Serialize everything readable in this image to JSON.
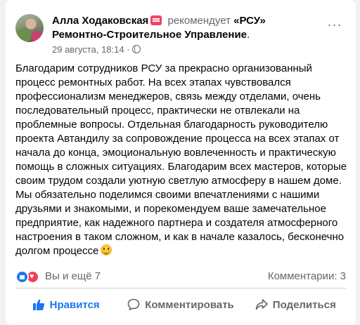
{
  "post": {
    "author": "Алла Ходаковская",
    "recommends_label": "рекомендует",
    "page_name": "«РСУ» Ремонтно-Строительное Управление",
    "page_name_suffix": ".",
    "timestamp": "29 августа, 18:14 ·",
    "body": "Благодарим сотрудников РСУ за прекрасно организованный процесс ремонтных работ. На всех этапах чувствовался профессионализм менеджеров, связь между отделами, очень последовательный процесс, практически не отвлекали на проблемные вопросы. Отдельная благодарность руководителю проекта Автандилу за сопровождение процесса на всех этапах от начала до конца, эмоциональную вовлеченность и практическую помощь в сложных ситуациях. Благодарим всех мастеров, которые своим трудом создали уютную светлую атмосферу в нашем доме. Мы обязательно поделимся своими впечатлениями с нашими друзьями и знакомыми, и порекомендуем ваше замечательное предприятие, как надежного партнера и создателя атмосферного настроения в таком сложном, и как в начале казалось, бесконечно долгом процессе"
  },
  "stats": {
    "reactors": "Вы и ещё 7",
    "comments": "Комментарии: 3"
  },
  "actions": {
    "like": "Нравится",
    "comment": "Комментировать",
    "share": "Поделиться"
  },
  "colors": {
    "accent": "#1877f2",
    "secondary_text": "#65676b",
    "love": "#f33e58"
  },
  "icons": [
    "avatar",
    "recommend-icon",
    "globe-icon",
    "more-icon",
    "smile-emoji-icon",
    "like-reaction-icon",
    "love-reaction-icon",
    "thumbs-up-icon",
    "comment-icon",
    "share-icon"
  ]
}
